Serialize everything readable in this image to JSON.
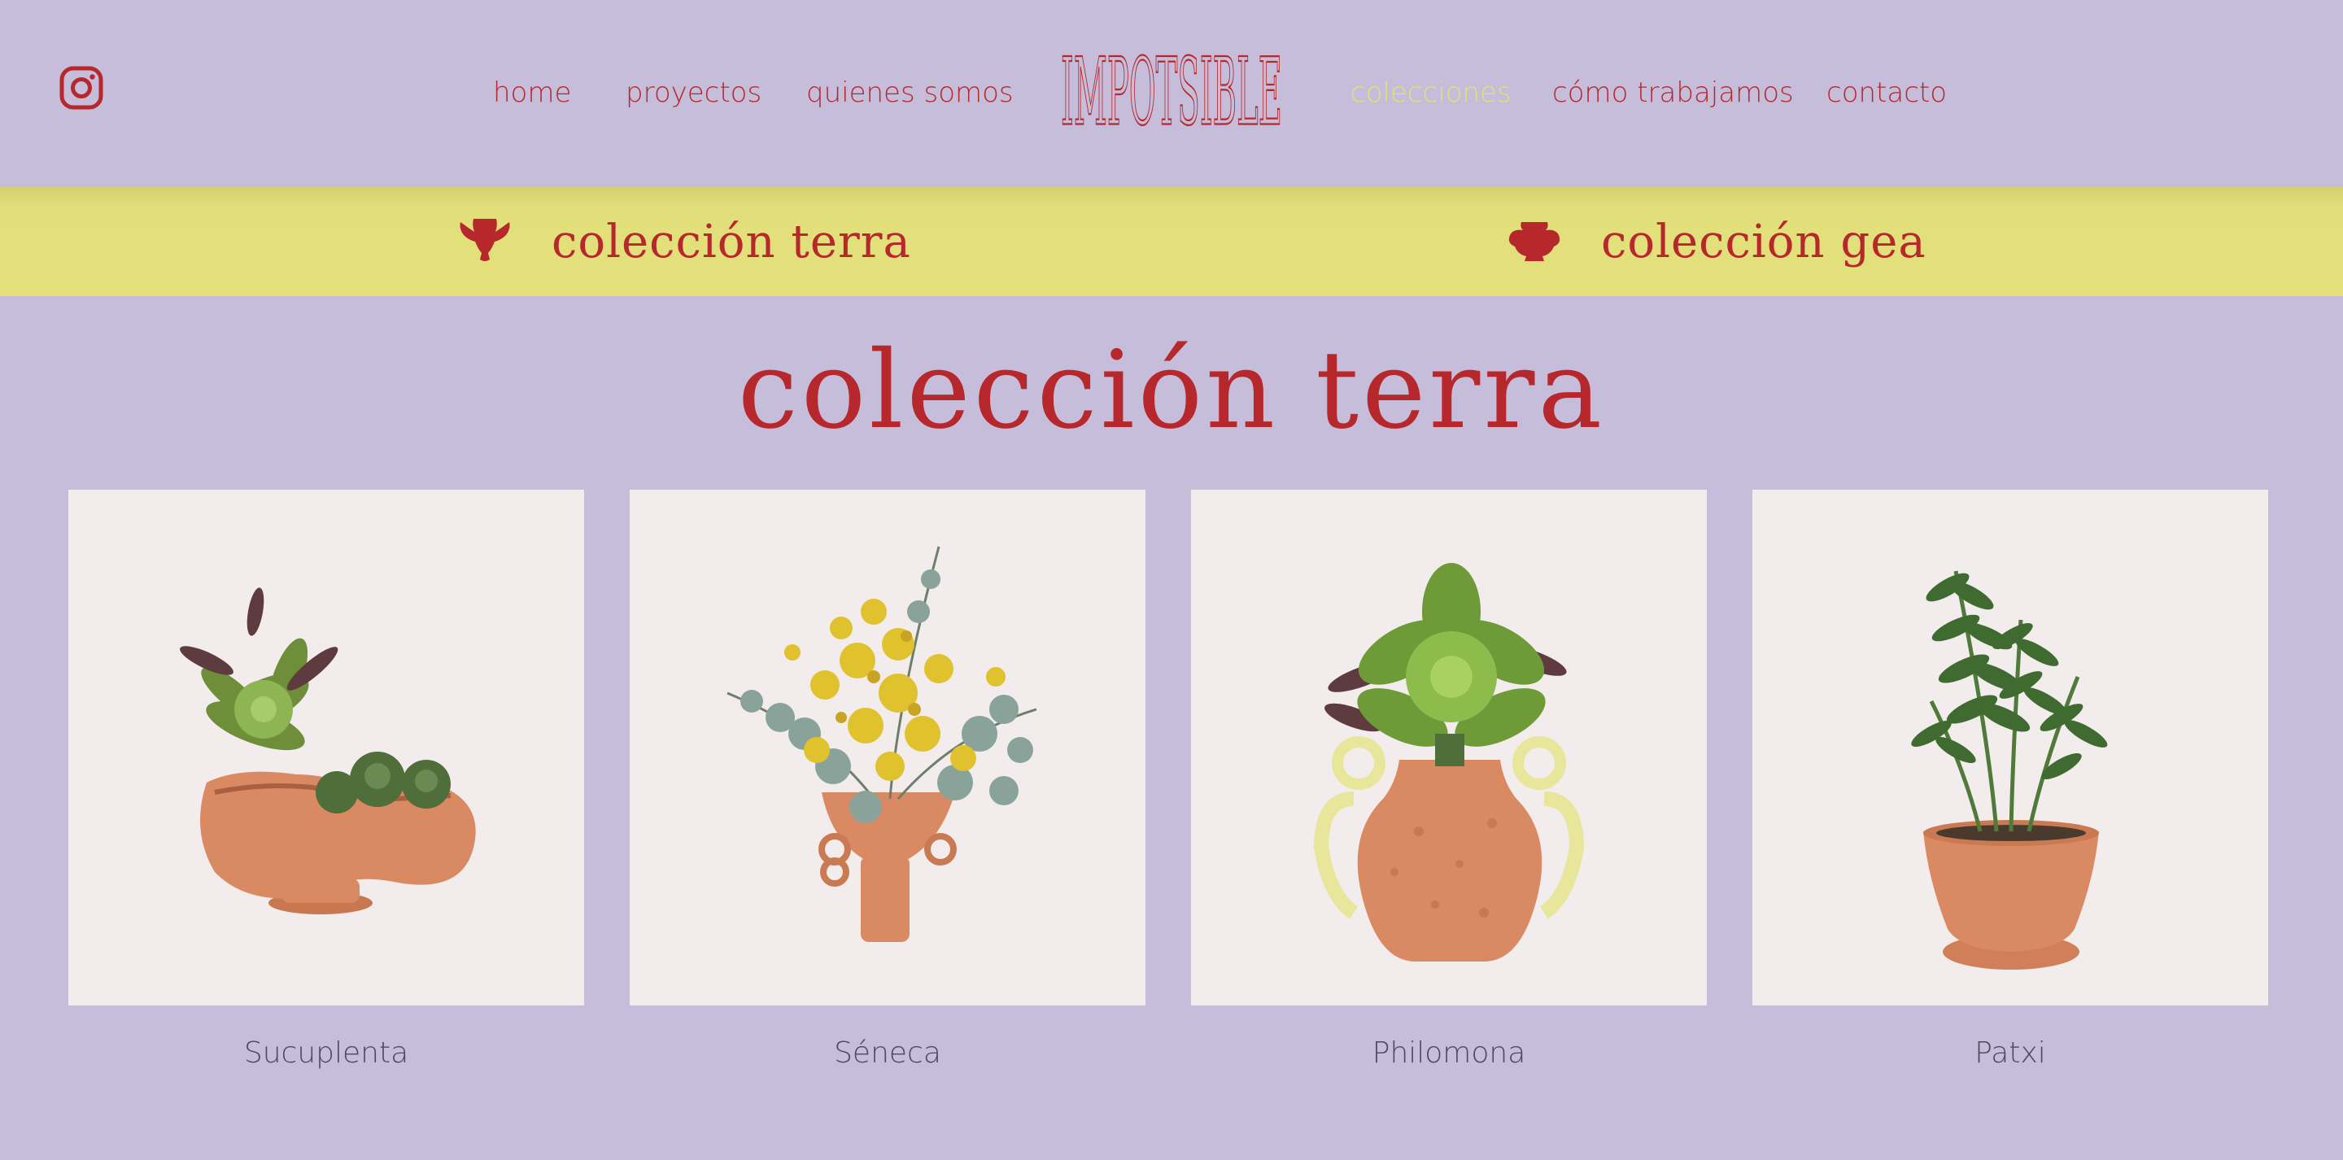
{
  "nav": {
    "home": "home",
    "proyectos": "proyectos",
    "quienes_somos": "quienes somos",
    "colecciones": "colecciones",
    "como_trabajamos": "cómo trabajamos",
    "contacto": "contacto",
    "logo_text": "IMPOTSIBLE"
  },
  "collections_bar": {
    "terra": "colección terra",
    "gea": "colección gea"
  },
  "page_title": "colección terra",
  "products": [
    {
      "name": "Sucuplenta"
    },
    {
      "name": "Séneca"
    },
    {
      "name": "Philomona"
    },
    {
      "name": "Patxi"
    }
  ],
  "colors": {
    "background": "#c5bdd9",
    "accent": "#b6282c",
    "band": "#e4e17c",
    "active_nav": "#e3e07a",
    "terracotta": "#d98a62"
  },
  "icons": {
    "social": "instagram-icon",
    "terra": "amphora-icon",
    "gea": "pot-icon"
  }
}
